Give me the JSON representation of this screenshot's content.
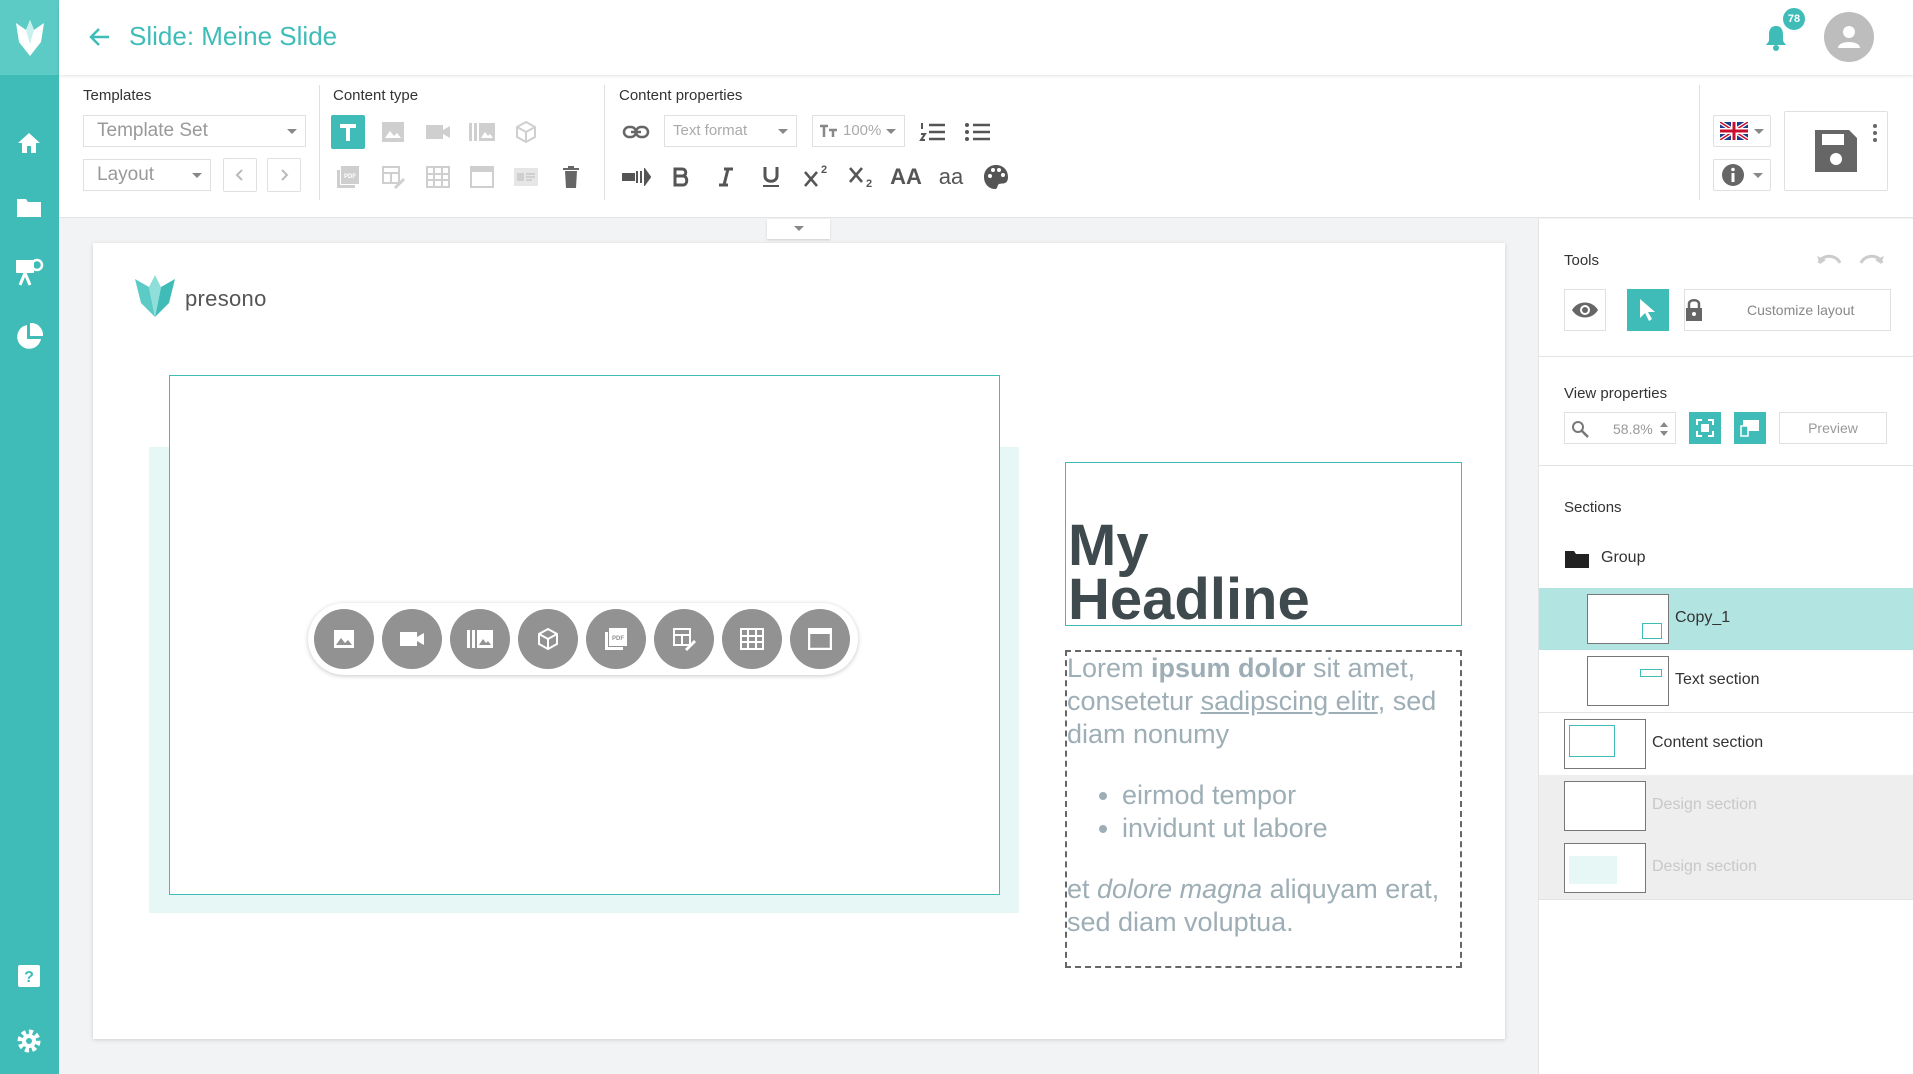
{
  "app": {
    "title": "Slide: Meine Slide",
    "notification_count": "78"
  },
  "rail": {
    "items": [
      {
        "icon": "home-icon"
      },
      {
        "icon": "folder-icon"
      },
      {
        "icon": "presentation-icon"
      },
      {
        "icon": "pie-chart-icon"
      },
      {
        "icon": "help-icon"
      },
      {
        "icon": "settings-icon"
      }
    ]
  },
  "toolbar": {
    "templates_label": "Templates",
    "template_set": "Template Set",
    "layout": "Layout",
    "content_type_label": "Content type",
    "content_properties_label": "Content properties",
    "text_format": "Text format",
    "font_size": "100%",
    "superscript_label": "2",
    "subscript_label": "2",
    "font_family_label": "AA",
    "font_case_label": "aa"
  },
  "slide": {
    "brand": "presono",
    "headline": "My Headline",
    "body": {
      "p1_a": "Lorem ",
      "p1_b": "ipsum dolor",
      "p1_c": " sit amet, consetetur ",
      "p1_d": "sadipscing elitr",
      "p1_e": ", sed diam nonumy",
      "bullets": [
        "eirmod tempor",
        "invidunt ut labore"
      ],
      "p2_a": "et ",
      "p2_b": "dolore magna",
      "p2_c": " aliquyam erat, sed diam voluptua."
    }
  },
  "panel": {
    "tools_label": "Tools",
    "customize_label": "Customize layout",
    "view_properties_label": "View properties",
    "zoom": "58.8%",
    "preview_label": "Preview",
    "sections_label": "Sections",
    "sections": [
      {
        "label": "Group"
      },
      {
        "label": "Copy_1"
      },
      {
        "label": "Text section"
      },
      {
        "label": "Content section"
      },
      {
        "label": "Design section"
      },
      {
        "label": "Design section"
      }
    ]
  },
  "colors": {
    "accent": "#3fbcb8",
    "accent_light": "#b2e4e1",
    "muted": "#9eaeb6",
    "headline": "#3f4a4e"
  }
}
